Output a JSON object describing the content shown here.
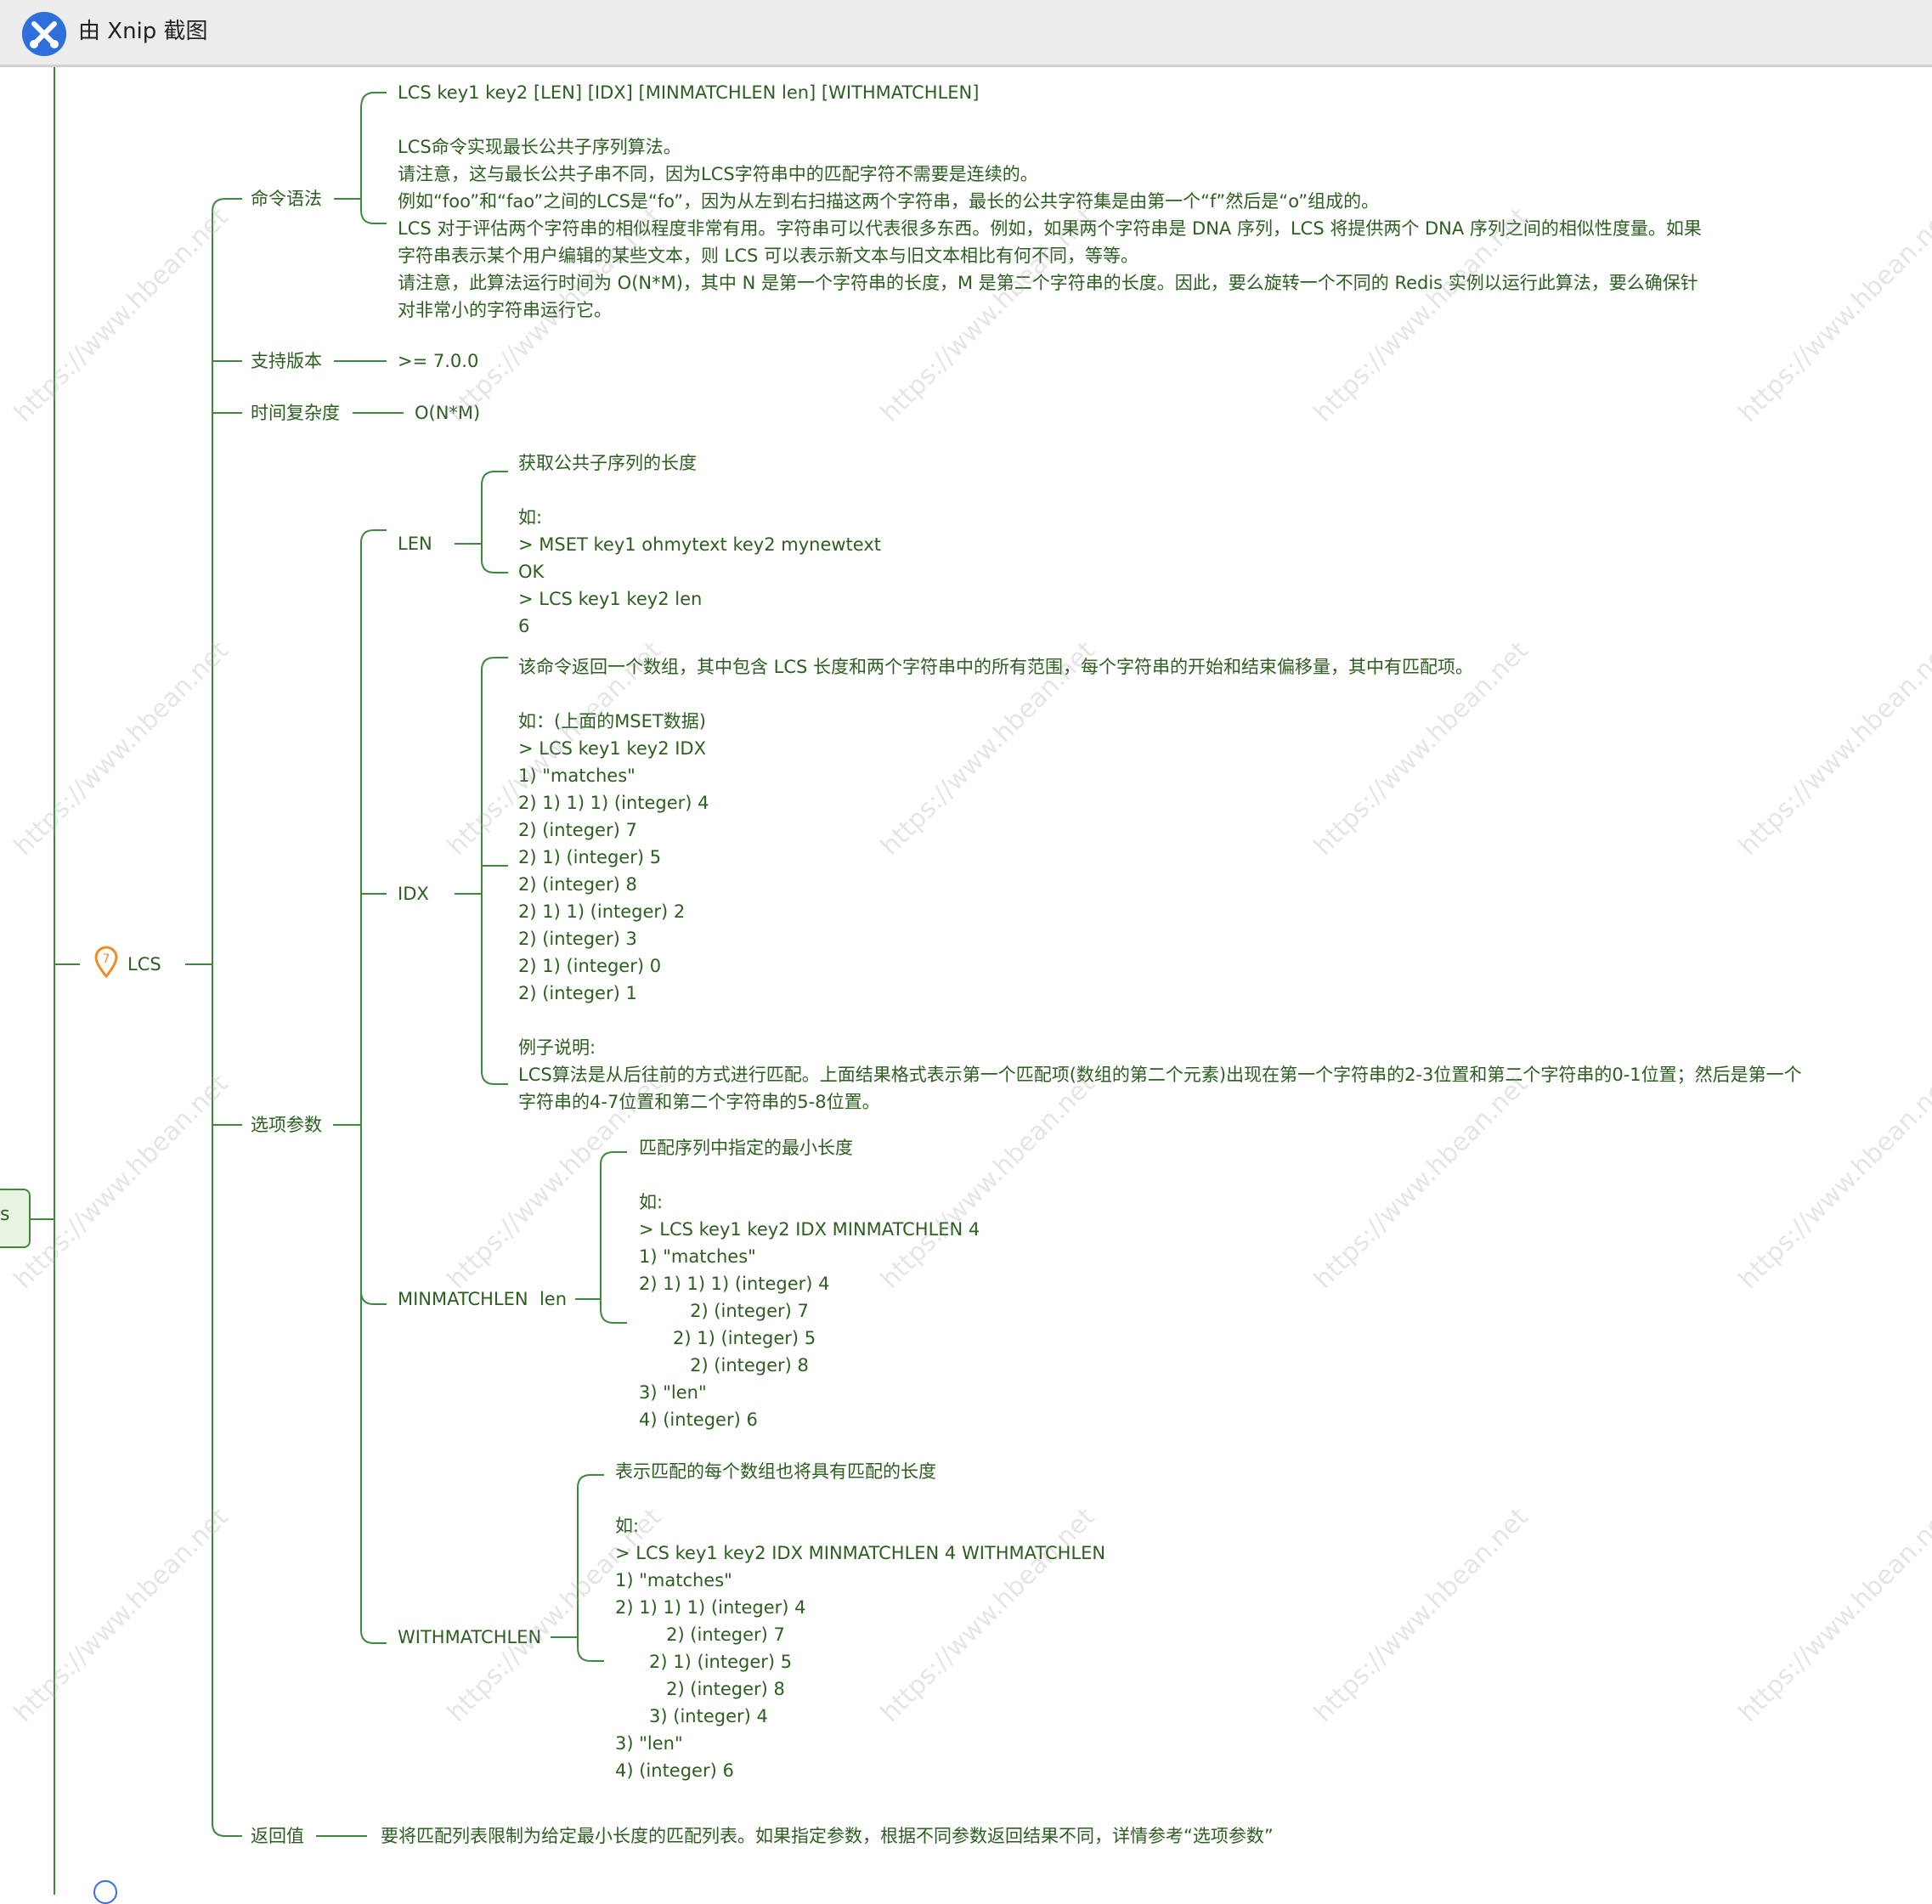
{
  "window": {
    "title": "由 Xnip 截图"
  },
  "root": {
    "label": "s"
  },
  "lcs": {
    "label": "LCS",
    "marker": "7",
    "syntax": {
      "label": "命令语法",
      "lines": [
        "LCS key1 key2 [LEN] [IDX] [MINMATCHLEN len] [WITHMATCHLEN]",
        "",
        "LCS命令实现最长公共子序列算法。",
        "请注意，这与最长公共子串不同，因为LCS字符串中的匹配字符不需要是连续的。",
        "例如“foo”和“fao”之间的LCS是“fo”，因为从左到右扫描这两个字符串，最长的公共字符集是由第一个“f”然后是“o”组成的。",
        "LCS 对于评估两个字符串的相似程度非常有用。字符串可以代表很多东西。例如，如果两个字符串是 DNA 序列，LCS 将提供两个 DNA 序列之间的相似性度量。如果字符串表示某个用户编辑的某些文本，则 LCS 可以表示新文本与旧文本相比有何不同，等等。",
        "请注意，此算法运行时间为 O(N*M)，其中 N 是第一个字符串的长度，M 是第二个字符串的长度。因此，要么旋转一个不同的 Redis 实例以运行此算法，要么确保针对非常小的字符串运行它。"
      ]
    },
    "version": {
      "label": "支持版本",
      "value": ">= 7.0.0"
    },
    "complexity": {
      "label": "时间复杂度",
      "value": "O(N*M)"
    },
    "options": {
      "label": "选项参数",
      "len": {
        "label": "LEN",
        "lines": [
          "获取公共子序列的长度",
          "",
          "如:",
          "> MSET key1 ohmytext key2 mynewtext",
          "OK",
          "> LCS key1 key2 len",
          "6"
        ]
      },
      "idx": {
        "label": "IDX",
        "lines": [
          "该命令返回一个数组，其中包含 LCS 长度和两个字符串中的所有范围，每个字符串的开始和结束偏移量，其中有匹配项。",
          "",
          "如：(上面的MSET数据)",
          "> LCS key1 key2 IDX",
          "1) \"matches\"",
          "2) 1) 1) 1) (integer) 4",
          "           2) (integer) 7",
          "        2) 1) (integer) 5",
          "            2) (integer) 8",
          "    2) 1) 1) (integer) 2",
          "           2) (integer) 3",
          "       2) 1) (integer) 0",
          "           2) (integer) 1",
          "",
          "例子说明:",
          "LCS算法是从后往前的方式进行匹配。上面结果格式表示第一个匹配项(数组的第二个元素)出现在第一个字符串的2-3位置和第二个字符串的0-1位置；然后是第一个字符串的4-7位置和第二个字符串的5-8位置。"
        ]
      },
      "minmatchlen": {
        "label": "MINMATCHLEN  len",
        "lines": [
          "匹配序列中指定的最小长度",
          "",
          "如:",
          "> LCS key1 key2 IDX MINMATCHLEN 4",
          "1) \"matches\"",
          "2) 1) 1) 1) (integer) 4",
          "         2) (integer) 7",
          "      2) 1) (integer) 5",
          "         2) (integer) 8",
          "3) \"len\"",
          "4) (integer) 6"
        ]
      },
      "withmatchlen": {
        "label": "WITHMATCHLEN",
        "lines": [
          "表示匹配的每个数组也将具有匹配的长度",
          "",
          "如:",
          "> LCS key1 key2 IDX MINMATCHLEN 4 WITHMATCHLEN",
          "1) \"matches\"",
          "2) 1) 1) 1) (integer) 4",
          "         2) (integer) 7",
          "      2) 1) (integer) 5",
          "         2) (integer) 8",
          "      3) (integer) 4",
          "3) \"len\"",
          "4) (integer) 6"
        ]
      }
    },
    "returns": {
      "label": "返回值",
      "value": "要将匹配列表限制为给定最小长度的匹配列表。如果指定参数，根据不同参数返回结果不同，详情参考“选项参数”"
    }
  },
  "watermark": {
    "text": "https://www.hbean.net"
  },
  "colors": {
    "line": "#3f8a3a",
    "text": "#2b5e1f",
    "marker": "#f08a24",
    "titlebar": "#ececec"
  }
}
